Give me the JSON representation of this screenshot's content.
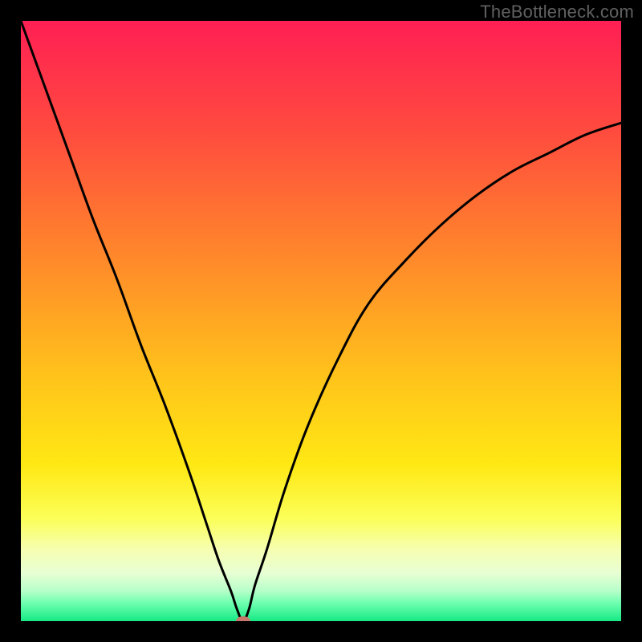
{
  "watermark": "TheBottleneck.com",
  "chart_data": {
    "type": "line",
    "title": "",
    "xlabel": "",
    "ylabel": "",
    "xlim": [
      0,
      100
    ],
    "ylim": [
      0,
      100
    ],
    "grid": false,
    "legend": false,
    "minimum": {
      "x": 37,
      "y": 0
    },
    "gradient_stops": [
      {
        "pct": 0,
        "color": "#ff1f54"
      },
      {
        "pct": 18,
        "color": "#ff4a3f"
      },
      {
        "pct": 40,
        "color": "#ff8a2a"
      },
      {
        "pct": 60,
        "color": "#ffc51a"
      },
      {
        "pct": 74,
        "color": "#ffe814"
      },
      {
        "pct": 83,
        "color": "#fbff59"
      },
      {
        "pct": 88,
        "color": "#f6ffb0"
      },
      {
        "pct": 92,
        "color": "#e8ffd4"
      },
      {
        "pct": 95,
        "color": "#b6ffc9"
      },
      {
        "pct": 97,
        "color": "#6dffb0"
      },
      {
        "pct": 100,
        "color": "#17e884"
      }
    ],
    "series": [
      {
        "name": "bottleneck-curve",
        "x": [
          0,
          4,
          8,
          12,
          16,
          20,
          24,
          28,
          31,
          33,
          35,
          36,
          37,
          38,
          39,
          41,
          44,
          48,
          53,
          58,
          64,
          70,
          76,
          82,
          88,
          94,
          100
        ],
        "y": [
          100,
          89,
          78,
          67,
          57,
          46,
          36,
          25,
          16,
          10,
          5,
          2,
          0,
          2,
          6,
          12,
          22,
          33,
          44,
          53,
          60,
          66,
          71,
          75,
          78,
          81,
          83
        ]
      }
    ],
    "marker": {
      "color": "#c7776c"
    }
  }
}
